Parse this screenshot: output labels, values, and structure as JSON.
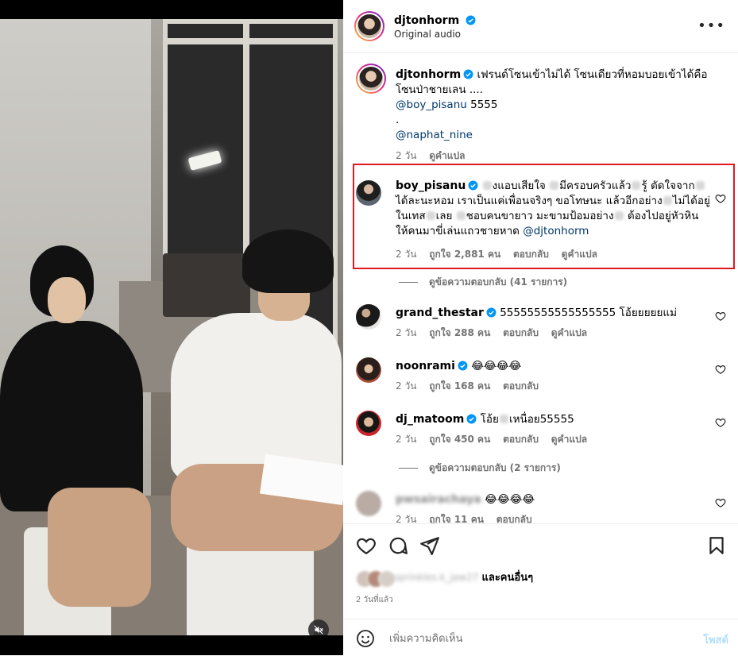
{
  "post": {
    "author": "djtonhorm",
    "audio": "Original audio",
    "more_icon": "more-horizontal-icon",
    "caption": {
      "author": "djtonhorm",
      "text": "เฟรนด์โซนเข้าไม่ได้ โซนเดียวที่หอมบอยเข้าได้คือโซนป่าชายเลน ....",
      "mention1": "@boy_pisanu",
      "mention1_suffix": "5555",
      "dot": ".",
      "mention2": "@naphat_nine",
      "time": "2 วัน",
      "translate": "ดูคำแปล"
    }
  },
  "comments": [
    {
      "user": "boy_pisanu",
      "verified": true,
      "text_parts": [
        "งแอบเสียใจ",
        "มีครอบครัวแล้ว",
        "รู้ ตัดใจจาก",
        "ได้ละนะหอม เราเป็นแค่เพื่อนจริงๆ ขอโทษนะ แล้วอีกอย่าง",
        "ไม่ได้อยู่ในเทส",
        "เลย",
        "ชอบคนขายาว มะขามป้อมอย่าง",
        "ต้องไปอยู่หัวหิน ให้คนมาขี่เล่นแถวชายหาด"
      ],
      "mention": "@djtonhorm",
      "time": "2 วัน",
      "likes": "ถูกใจ 2,881 คน",
      "reply": "ตอบกลับ",
      "translate": "ดูคำแปล",
      "view_replies": "ดูข้อความตอบกลับ (41 รายการ)"
    },
    {
      "user": "grand_thestar",
      "verified": true,
      "text": "55555555555555555 โอ้ยยยยยแม่",
      "time": "2 วัน",
      "likes": "ถูกใจ 288 คน",
      "reply": "ตอบกลับ",
      "translate": "ดูคำแปล"
    },
    {
      "user": "noonrami",
      "verified": true,
      "text": "😂😂😂😂",
      "time": "2 วัน",
      "likes": "ถูกใจ 168 คน",
      "reply": "ตอบกลับ"
    },
    {
      "user": "dj_matoom",
      "verified": true,
      "text_a": "โอ้ย",
      "text_b": "เหนื่อย55555",
      "time": "2 วัน",
      "likes": "ถูกใจ 450 คน",
      "reply": "ตอบกลับ",
      "translate": "ดูคำแปล",
      "view_replies": "ดูข้อความตอบกลับ (2 รายการ)"
    },
    {
      "user": "pwsairachaya",
      "text": "😂😂😂😂",
      "time": "2 วัน",
      "likes": "ถูกใจ 11 คน",
      "reply": "ตอบกลับ"
    }
  ],
  "footer": {
    "liked_by_user": "sprinkles.k_jaw27",
    "and_others": "และคนอื่นๆ",
    "time_ago": "2 วันที่แล้ว",
    "comment_placeholder": "เพิ่มความคิดเห็น",
    "post_label": "โพสต์"
  },
  "colors": {
    "verified": "#0095f6",
    "highlight_border": "#e0191f",
    "secondary_text": "#737373",
    "post_button_disabled": "#b2dffc"
  }
}
